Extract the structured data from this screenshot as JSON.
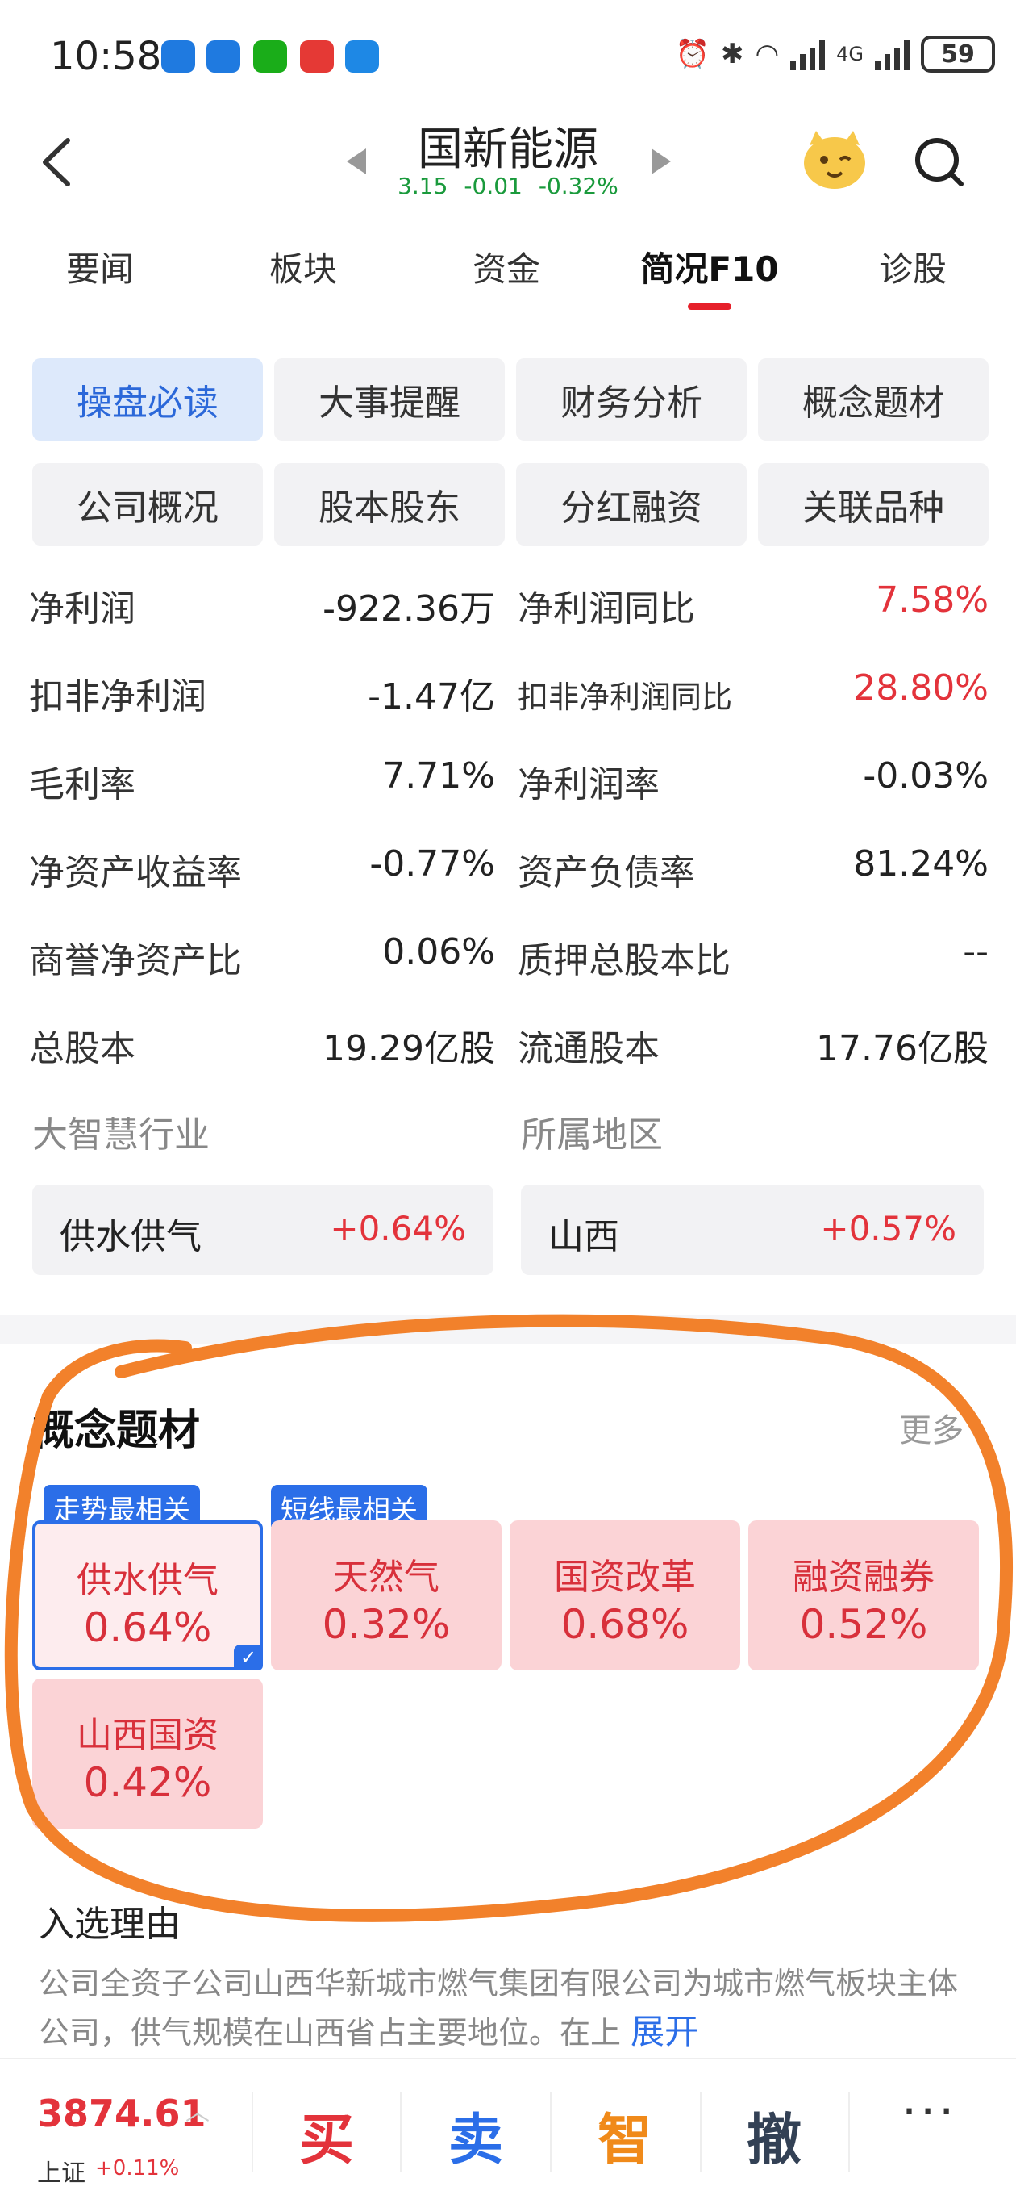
{
  "status_bar": {
    "time": "10:58",
    "network": "4G",
    "battery": "59",
    "app_icons": [
      {
        "name": "shield-app-icon-1",
        "color": "#1f7ae0"
      },
      {
        "name": "shield-app-icon-2",
        "color": "#1f7ae0"
      },
      {
        "name": "wechat-icon",
        "color": "#1aad19"
      },
      {
        "name": "red-app-icon",
        "color": "#e53935"
      },
      {
        "name": "car-app-icon",
        "color": "#1e88e5"
      }
    ]
  },
  "header": {
    "stock_name": "国新能源",
    "price": "3.15",
    "change": "-0.01",
    "change_pct": "-0.32%"
  },
  "tabs": [
    "要闻",
    "板块",
    "资金",
    "简况F10",
    "诊股"
  ],
  "active_tab": "简况F10",
  "sub_buttons": [
    "操盘必读",
    "大事提醒",
    "财务分析",
    "概念题材",
    "公司概况",
    "股本股东",
    "分红融资",
    "关联品种"
  ],
  "metrics": [
    {
      "l_label": "净利润",
      "l_value": "-922.36万",
      "r_label": "净利润同比",
      "r_value": "7.58%"
    },
    {
      "l_label": "扣非净利润",
      "l_value": "-1.47亿",
      "r_label": "扣非净利润同比",
      "r_value": "28.80%"
    },
    {
      "l_label": "毛利率",
      "l_value": "7.71%",
      "r_label": "净利润率",
      "r_value": "-0.03%"
    },
    {
      "l_label": "净资产收益率",
      "l_value": "-0.77%",
      "r_label": "资产负债率",
      "r_value": "81.24%"
    },
    {
      "l_label": "商誉净资产比",
      "l_value": "0.06%",
      "r_label": "质押总股本比",
      "r_value": "--"
    },
    {
      "l_label": "总股本",
      "l_value": "19.29亿股",
      "r_label": "流通股本",
      "r_value": "17.76亿股"
    }
  ],
  "industry": {
    "label": "大智慧行业",
    "name": "供水供气",
    "change": "+0.64%"
  },
  "region": {
    "label": "所属地区",
    "name": "山西",
    "change": "+0.57%"
  },
  "concept": {
    "title": "概念题材",
    "more": "更多",
    "tag_trend": "走势最相关",
    "tag_short": "短线最相关",
    "items": [
      {
        "name": "供水供气",
        "value": "0.64%"
      },
      {
        "name": "天然气",
        "value": "0.32%"
      },
      {
        "name": "国资改革",
        "value": "0.68%"
      },
      {
        "name": "融资融券",
        "value": "0.52%"
      },
      {
        "name": "山西国资",
        "value": "0.42%"
      }
    ],
    "reason_title": "入选理由",
    "reason_text": "公司全资子公司山西华新城市燃气集团有限公司为城市燃气板块主体公司，供气规模在山西省占主要地位。在上",
    "expand": "展开"
  },
  "bottom_bar": {
    "index_value": "3874.61",
    "index_name": "上证",
    "index_change": "+0.11%",
    "buy": "买",
    "sell": "卖",
    "smart": "智",
    "cancel": "撤",
    "more": "···"
  },
  "colors": {
    "red": "#e3333b",
    "green": "#1a9a3c",
    "blue": "#2b6ee8",
    "orange_annotation": "#f2812b"
  }
}
